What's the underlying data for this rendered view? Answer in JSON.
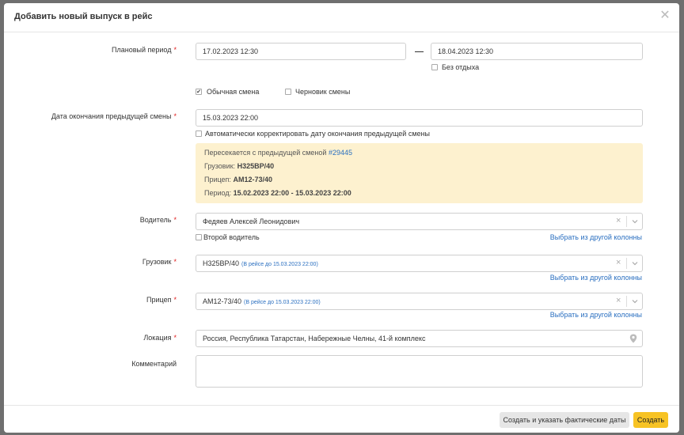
{
  "modal": {
    "title": "Добавить новый выпуск в рейс",
    "close_icon": "close-icon"
  },
  "planned_period": {
    "label": "Плановый период",
    "required_mark": "*",
    "start_value": "17.02.2023 12:30",
    "end_value": "18.04.2023 12:30",
    "no_rest_label": "Без отдыха",
    "no_rest_checked": false
  },
  "shift_type": {
    "regular_label": "Обычная смена",
    "regular_checked": true,
    "draft_label": "Черновик смены",
    "draft_checked": false,
    "check_mark": "✔"
  },
  "prev_shift_end": {
    "label": "Дата окончания предыдущей смены",
    "required_mark": "*",
    "value": "15.03.2023 22:00",
    "auto_correct_label": "Автоматически корректировать дату окончания предыдущей смены",
    "auto_correct_checked": false
  },
  "overlap_warning": {
    "line1_text": "Пересекается с предыдущей сменой",
    "line1_link": "#29445",
    "truck_label": "Грузовик:",
    "truck_value": "Н325ВР/40",
    "trailer_label": "Прицеп:",
    "trailer_value": "АМ12-73/40",
    "period_label": "Период:",
    "period_value": "15.02.2023 22:00 - 15.03.2023 22:00"
  },
  "driver": {
    "label": "Водитель",
    "required_mark": "*",
    "value": "Федяев Алексей Леонидович",
    "second_driver_label": "Второй водитель",
    "second_driver_checked": false,
    "other_column_link": "Выбрать из другой колонны"
  },
  "truck": {
    "label": "Грузовик",
    "required_mark": "*",
    "value": "Н325ВР/40",
    "hint": "(В рейсе до 15.03.2023 22:00)",
    "other_column_link": "Выбрать из другой колонны"
  },
  "trailer": {
    "label": "Прицеп",
    "required_mark": "*",
    "value": "АМ12-73/40",
    "hint": "(В рейсе до 15.03.2023 22:00)",
    "other_column_link": "Выбрать из другой колонны"
  },
  "location": {
    "label": "Локация",
    "required_mark": "*",
    "value": "Россия, Республика Татарстан, Набережные Челны, 41-й комплекс",
    "icon": "map-pin-icon"
  },
  "comment": {
    "label": "Комментарий",
    "value": ""
  },
  "select_controls": {
    "clear_glyph": "×"
  },
  "footer": {
    "create_with_actual_label": "Создать и указать фактические даты",
    "create_label": "Создать",
    "primary_color": "#f7c324"
  }
}
